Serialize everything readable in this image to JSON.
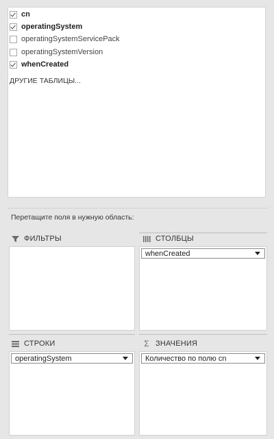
{
  "fields": [
    {
      "label": "cn",
      "checked": true
    },
    {
      "label": "operatingSystem",
      "checked": true
    },
    {
      "label": "operatingSystemServicePack",
      "checked": false
    },
    {
      "label": "operatingSystemVersion",
      "checked": false
    },
    {
      "label": "whenCreated",
      "checked": true
    }
  ],
  "more_tables_label": "ДРУГИЕ ТАБЛИЦЫ...",
  "drag_hint": "Перетащите поля в нужную область:",
  "areas": {
    "filters": {
      "title": "ФИЛЬТРЫ",
      "icon": "filter-icon"
    },
    "columns": {
      "title": "СТОЛБЦЫ",
      "icon": "columns-icon",
      "item": "whenCreated"
    },
    "rows": {
      "title": "СТРОКИ",
      "icon": "rows-icon",
      "item": "operatingSystem"
    },
    "values": {
      "title": "ЗНАЧЕНИЯ",
      "icon": "sigma-icon",
      "symbol": "Σ",
      "item": "Количество по полю cn"
    }
  }
}
